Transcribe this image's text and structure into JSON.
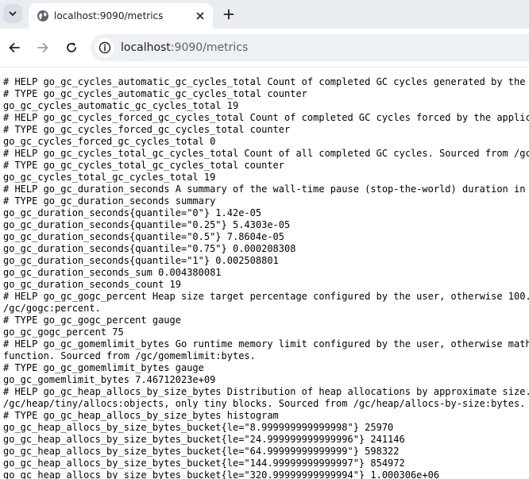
{
  "tab": {
    "title": "localhost:9090/metrics",
    "favicon": "globe-icon",
    "close_icon": "close-icon"
  },
  "toolbar": {
    "back_icon": "back-arrow-icon",
    "forward_icon": "forward-arrow-icon",
    "reload_icon": "reload-icon",
    "site_info_icon": "site-info-icon",
    "url_host": "localhost",
    "url_path": ":9090/metrics"
  },
  "metrics_lines": [
    "# HELP go_gc_cycles_automatic_gc_cycles_total Count of completed GC cycles generated by the Go",
    "# TYPE go_gc_cycles_automatic_gc_cycles_total counter",
    "go_gc_cycles_automatic_gc_cycles_total 19",
    "# HELP go_gc_cycles_forced_gc_cycles_total Count of completed GC cycles forced by the applica",
    "# TYPE go_gc_cycles_forced_gc_cycles_total counter",
    "go_gc_cycles_forced_gc_cycles_total 0",
    "# HELP go_gc_cycles_total_gc_cycles_total Count of all completed GC cycles. Sourced from /gc/cy",
    "# TYPE go_gc_cycles_total_gc_cycles_total counter",
    "go_gc_cycles_total_gc_cycles_total 19",
    "# HELP go_gc_duration_seconds A summary of the wall-time pause (stop-the-world) duration in gar",
    "# TYPE go_gc_duration_seconds summary",
    "go_gc_duration_seconds{quantile=\"0\"} 1.42e-05",
    "go_gc_duration_seconds{quantile=\"0.25\"} 5.4303e-05",
    "go_gc_duration_seconds{quantile=\"0.5\"} 7.8604e-05",
    "go_gc_duration_seconds{quantile=\"0.75\"} 0.000208308",
    "go_gc_duration_seconds{quantile=\"1\"} 0.002508801",
    "go_gc_duration_seconds_sum 0.004380081",
    "go_gc_duration_seconds_count 19",
    "# HELP go_gc_gogc_percent Heap size target percentage configured by the user, otherwise 100. Th",
    "/gc/gogc:percent.",
    "# TYPE go_gc_gogc_percent gauge",
    "go_gc_gogc_percent 75",
    "# HELP go_gc_gomemlimit_bytes Go runtime memory limit configured by the user, otherwise math.Ma",
    "function. Sourced from /gc/gomemlimit:bytes.",
    "# TYPE go_gc_gomemlimit_bytes gauge",
    "go_gc_gomemlimit_bytes 7.46712023e+09",
    "# HELP go_gc_heap_allocs_by_size_bytes Distribution of heap allocations by approximate size. Bu",
    "/gc/heap/tiny/allocs:objects, only tiny blocks. Sourced from /gc/heap/allocs-by-size:bytes.",
    "# TYPE go_gc_heap_allocs_by_size_bytes histogram",
    "go_gc_heap_allocs_by_size_bytes_bucket{le=\"8.999999999999998\"} 25970",
    "go_gc_heap_allocs_by_size_bytes_bucket{le=\"24.999999999999996\"} 241146",
    "go_gc_heap_allocs_by_size_bytes_bucket{le=\"64.99999999999999\"} 598322",
    "go_gc_heap_allocs_by_size_bytes_bucket{le=\"144.99999999999997\"} 854972",
    "go_gc_heap_allocs_by_size_bytes_bucket{le=\"320.99999999999994\"} 1.000306e+06"
  ]
}
